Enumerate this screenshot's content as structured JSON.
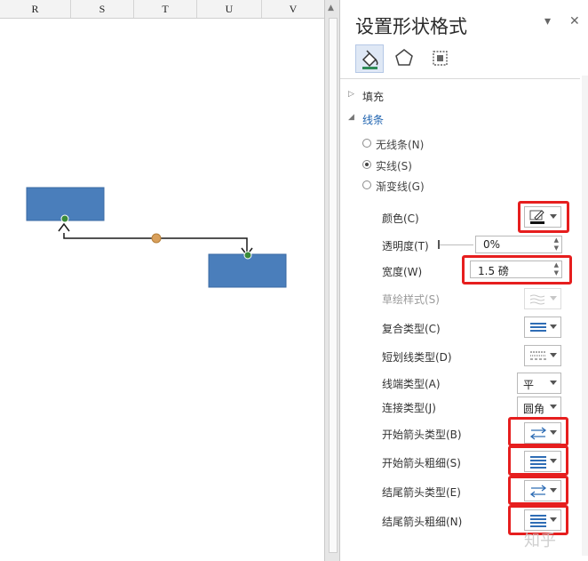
{
  "sheet": {
    "columns": [
      "R",
      "S",
      "T",
      "U",
      "V"
    ]
  },
  "pane": {
    "title": "设置形状格式",
    "dropdown_glyph": "▾",
    "close_glyph": "✕",
    "tab_icons": [
      "fill-line-icon",
      "effects-icon",
      "size-properties-icon"
    ],
    "fill_section": "填充",
    "line_section": "线条",
    "line_options": [
      {
        "label": "无线条(N)",
        "selected": false
      },
      {
        "label": "实线(S)",
        "selected": true
      },
      {
        "label": "渐变线(G)",
        "selected": false
      }
    ],
    "props": {
      "color_label": "颜色(C)",
      "transparency_label": "透明度(T)",
      "transparency_value": "0%",
      "width_label": "宽度(W)",
      "width_value": "1.5 磅",
      "sketch_label": "草绘样式(S)",
      "compound_label": "复合类型(C)",
      "dash_label": "短划线类型(D)",
      "cap_label": "线端类型(A)",
      "cap_value": "平",
      "join_label": "连接类型(J)",
      "join_value": "圆角",
      "begin_arrow_type_label": "开始箭头类型(B)",
      "begin_arrow_size_label": "开始箭头粗细(S)",
      "end_arrow_type_label": "结尾箭头类型(E)",
      "end_arrow_size_label": "结尾箭头粗细(N)"
    },
    "accent_color": "#1e63b0",
    "highlight_color": "#e61e1e"
  },
  "shapes": {
    "box_color": "#4a7ebb",
    "connector_color": "#1a1a1a",
    "midpoint_color": "#d9a05b",
    "handle_color": "#3a8a3a"
  },
  "watermark": "知乎"
}
